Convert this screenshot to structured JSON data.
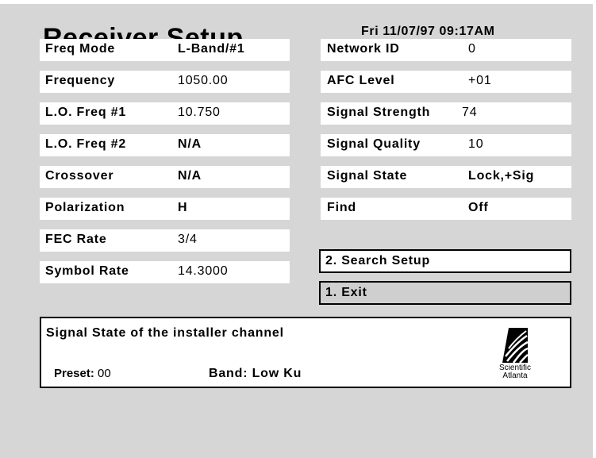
{
  "header": {
    "title": "Receiver Setup",
    "datetime": "Fri 11/07/97 09:17AM"
  },
  "left_fields": [
    {
      "label": "Freq Mode",
      "value": "L-Band/#1"
    },
    {
      "label": "Frequency",
      "value": "1050.00"
    },
    {
      "label": "L.O. Freq #1",
      "value": "10.750"
    },
    {
      "label": "L.O. Freq #2",
      "value": "N/A"
    },
    {
      "label": "Crossover",
      "value": "N/A"
    },
    {
      "label": "Polarization",
      "value": "H"
    },
    {
      "label": "FEC Rate",
      "value": "3/4"
    },
    {
      "label": "Symbol Rate",
      "value": "14.3000"
    }
  ],
  "right_fields": [
    {
      "label": "Network ID",
      "value": "0"
    },
    {
      "label": "AFC Level",
      "value": "+01"
    },
    {
      "label": "Signal Strength",
      "value": "74"
    },
    {
      "label": "Signal Quality",
      "value": "10"
    },
    {
      "label": "Signal State",
      "value": "Lock,+Sig"
    },
    {
      "label": "Find",
      "value": "Off"
    }
  ],
  "menu": {
    "search_setup": "2. Search Setup",
    "exit": "1. Exit"
  },
  "info": {
    "message": "Signal State of the installer channel",
    "preset_label": "Preset:",
    "preset_value": "00",
    "band": "Band: Low Ku",
    "logo_line1": "Scientific",
    "logo_line2": "Atlanta"
  },
  "colors": {
    "screen_background": "#d6d6d6",
    "field_background": "#ffffff",
    "text": "#000000"
  }
}
